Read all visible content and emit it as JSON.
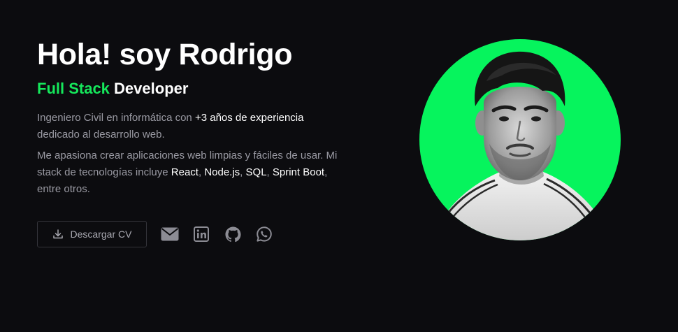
{
  "hero": {
    "title": "Hola! soy Rodrigo",
    "subtitle_accent": "Full Stack",
    "subtitle_rest": "Developer",
    "para1": {
      "text_a": "Ingeniero Civil en informática con ",
      "highlight": "+3 años de experiencia",
      "text_b": " dedicado al desarrollo web."
    },
    "para2": {
      "text_a": "Me apasiona crear aplicaciones web limpias y fáciles de usar. Mi stack de tecnologías incluye ",
      "tech1": "React",
      "sep1": ", ",
      "tech2": "Node.js",
      "sep2": ", ",
      "tech3": "SQL",
      "sep3": ", ",
      "tech4": "Sprint Boot",
      "text_b": ", entre otros."
    }
  },
  "actions": {
    "download_label": "Descargar CV",
    "download_icon": "download-icon",
    "social": [
      "mail-icon",
      "linkedin-icon",
      "github-icon",
      "whatsapp-icon"
    ]
  },
  "colors": {
    "background": "#0c0c0f",
    "accent": "#15e85b",
    "text_primary": "#ffffff",
    "text_muted": "#9a9aa3",
    "icon": "#8c8c94"
  }
}
